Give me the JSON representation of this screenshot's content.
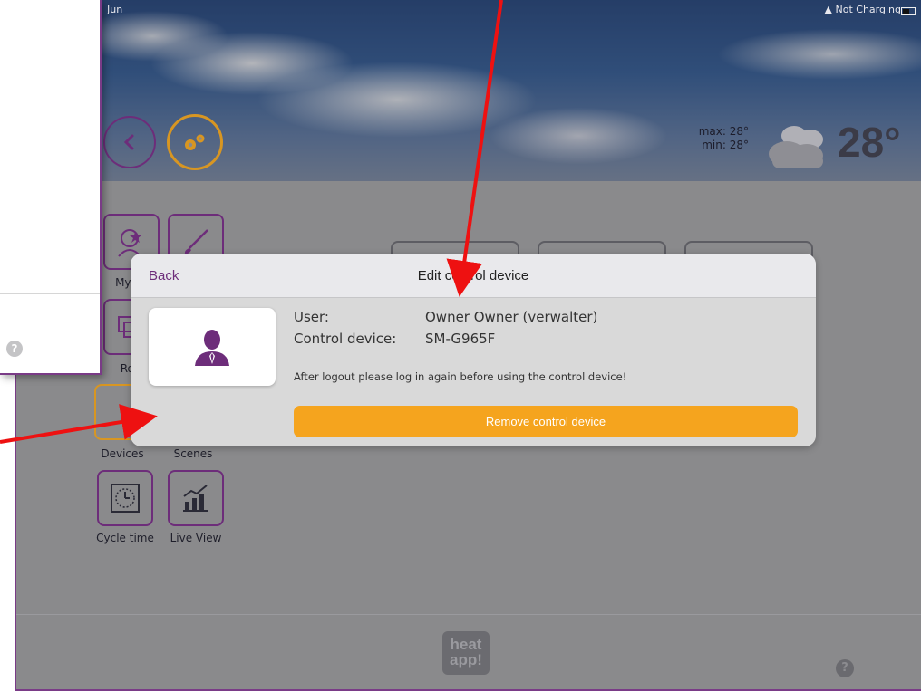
{
  "status_bar": {
    "left_text": "Jun",
    "right_text": "Not Charging"
  },
  "weather": {
    "max": "max: 28°",
    "min": "min: 28°",
    "temperature": "28°"
  },
  "tiles": [
    {
      "label": "My pr"
    },
    {
      "label": ""
    },
    {
      "label": "Roo"
    },
    {
      "label": "Devices"
    },
    {
      "label": "Scenes"
    },
    {
      "label": "Cycle time"
    },
    {
      "label": "Live View"
    }
  ],
  "footer": {
    "logo_line1": "heat",
    "logo_line2": "app!",
    "help": "?"
  },
  "left_panel": {
    "help": "?"
  },
  "modal": {
    "back_label": "Back",
    "title": "Edit control device",
    "user_label": "User:",
    "user_value": "Owner Owner (verwalter)",
    "device_label": "Control device:",
    "device_value": "SM-G965F",
    "note": "After logout please log in again before using the control device!",
    "remove_button": "Remove control device"
  },
  "colors": {
    "accent_purple": "#6d2d7a",
    "accent_orange": "#f5a41e",
    "annotation_red": "#ee1111"
  },
  "icons": [
    "back-chevron-icon",
    "settings-gears-icon",
    "cloud-icon",
    "wifi-icon",
    "battery-icon",
    "user-avatar-icon",
    "clock-icon",
    "chart-icon",
    "star-profile-icon",
    "brush-icon"
  ]
}
